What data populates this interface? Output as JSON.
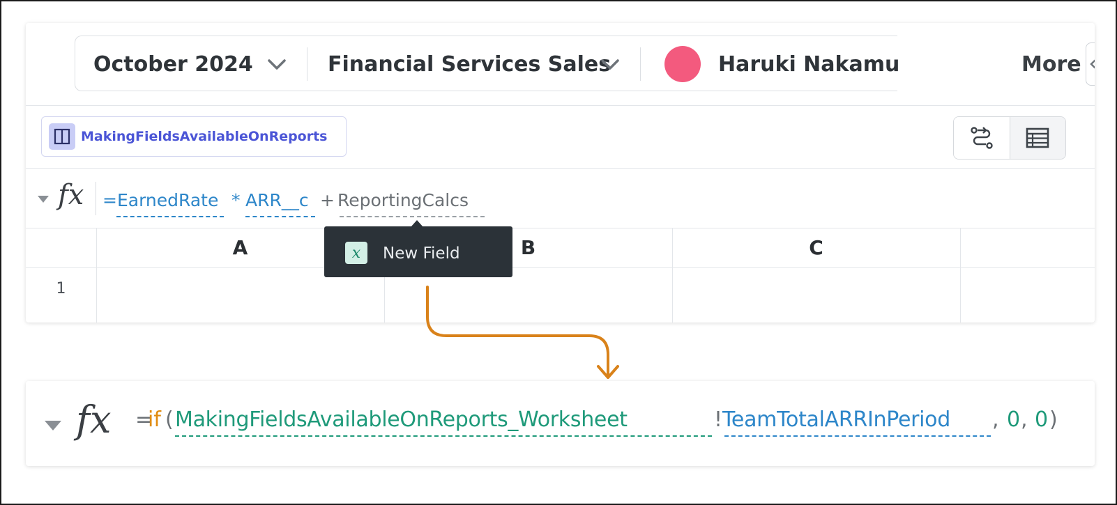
{
  "filters": {
    "period": "October 2024",
    "team": "Financial Services Sales",
    "user": "Haruki Nakamu",
    "more_label": "More"
  },
  "worksheet": {
    "name": "MakingFieldsAvailableOnReports"
  },
  "formula_bar": {
    "fx": "fx",
    "tokens": [
      {
        "text": "=EarnedRate",
        "color": "#2d86c9"
      },
      {
        "text": "*",
        "color": "#2d86c9"
      },
      {
        "text": "ARR__c",
        "color": "#2d86c9"
      },
      {
        "text": "+",
        "color": "#6b7075"
      },
      {
        "text": "ReportingCalcs",
        "color": "#6b7075"
      }
    ]
  },
  "grid": {
    "columns": [
      "A",
      "B",
      "C"
    ],
    "rows": [
      "1"
    ]
  },
  "tooltip": {
    "icon_glyph": "x",
    "label": "New Field"
  },
  "formula_result": {
    "fx": "fx",
    "tokens": [
      {
        "text": "=",
        "color": "#6b7075"
      },
      {
        "text": "if",
        "color": "#e08c12"
      },
      {
        "text": "(",
        "color": "#6b7075"
      },
      {
        "text": "MakingFieldsAvailableOnReports_Worksheet",
        "color": "#1f9a7a"
      },
      {
        "text": "!",
        "color": "#6b7075"
      },
      {
        "text": "TeamTotalARRInPeriod",
        "color": "#2d86c9"
      },
      {
        "text": ",",
        "color": "#6b7075"
      },
      {
        "text": "0",
        "color": "#1f9a7a"
      },
      {
        "text": ",",
        "color": "#6b7075"
      },
      {
        "text": "0",
        "color": "#1f9a7a"
      },
      {
        "text": ")",
        "color": "#6b7075"
      }
    ]
  },
  "colors": {
    "accent_blue": "#2d86c9",
    "accent_teal": "#1f9a7a",
    "accent_orange": "#e08c12",
    "worksheet_purple": "#4b55d6",
    "avatar_pink": "#f35a7e",
    "arrow": "#d9821a"
  }
}
